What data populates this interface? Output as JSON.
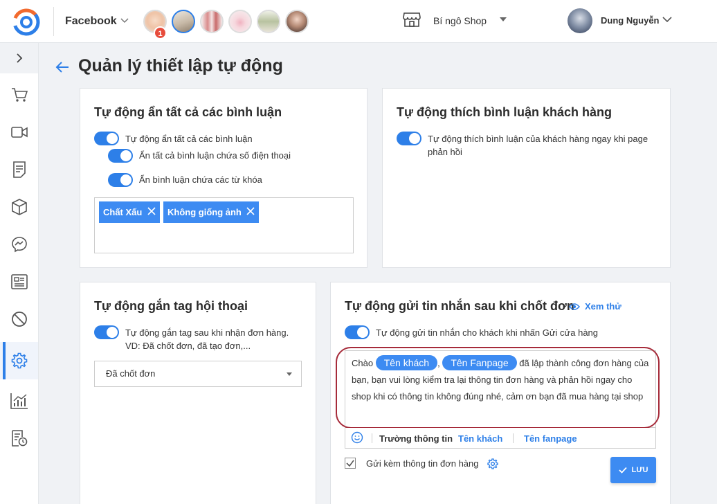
{
  "topbar": {
    "platform": "Facebook",
    "avatar_badge": "1",
    "shop_name": "Bí ngô Shop",
    "user_name": "Dung Nguyễn"
  },
  "page": {
    "title": "Quản lý thiết lập tự động"
  },
  "card_hide": {
    "title": "Tự động ẩn tất cả các bình luận",
    "opt_main": "Tự động ẩn tất cả các bình luận",
    "opt_phone": "Ẩn tất cả bình luận chứa số điện thoại",
    "opt_keywords": "Ẩn bình luận chứa các từ khóa",
    "keywords": [
      "Chất Xấu",
      "Không giống ảnh"
    ]
  },
  "card_like": {
    "title": "Tự động thích bình luận khách hàng",
    "opt": "Tự động thích bình luận của khách hàng ngay khi page phản hồi"
  },
  "card_tag": {
    "title": "Tự động gắn tag hội thoại",
    "opt": "Tự động gắn tag sau khi nhận đơn hàng. VD: Đã chốt đơn, đã tạo đơn,...",
    "selected": "Đã chốt đơn"
  },
  "card_msg": {
    "title": "Tự động gửi tin nhắn sau khi chốt đơn",
    "preview_link": "Xem thử",
    "opt": "Tự động gửi tin nhắn cho khách khi nhấn Gửi cửa hàng",
    "msg_prefix": "Chào",
    "msg_pill_customer": "Tên khách",
    "msg_comma": ",",
    "msg_pill_fanpage": "Tên Fanpage",
    "msg_rest": "đã lập thành công đơn hàng của bạn, bạn vui lòng kiểm tra lại thông tin đơn hàng và phản hồi ngay cho shop khi có thông tin không đúng nhé, cảm ơn bạn đã mua hàng tại shop",
    "fields_label": "Trường thông tin",
    "field_customer": "Tên khách",
    "field_fanpage": "Tên fanpage",
    "attach_label": "Gửi kèm thông tin đơn hàng",
    "save_label": "LƯU"
  },
  "colors": {
    "accent": "#2d7fe8",
    "chip": "#3d8bf2",
    "highlight_ring": "#a62b3a"
  }
}
